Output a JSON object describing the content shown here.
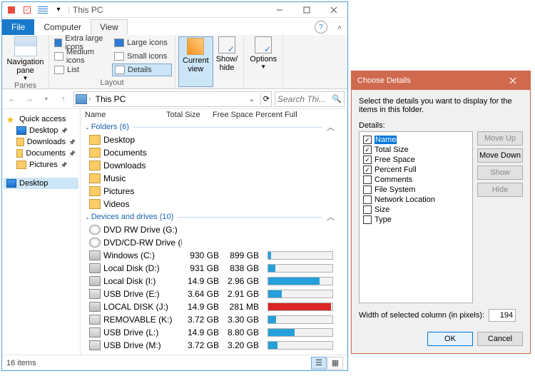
{
  "title": "This PC",
  "ribbonTabs": {
    "file": "File",
    "computer": "Computer",
    "view": "View"
  },
  "ribbon": {
    "panes": {
      "nav": "Navigation\npane",
      "label": "Panes"
    },
    "layout": {
      "xl": "Extra large icons",
      "lg": "Large icons",
      "md": "Medium icons",
      "sm": "Small icons",
      "list": "List",
      "details": "Details",
      "label": "Layout"
    },
    "currentview": "Current\nview",
    "showhide": "Show/\nhide",
    "options": "Options"
  },
  "address": {
    "path": "This PC",
    "searchPlaceholder": "Search Thi..."
  },
  "tree": {
    "quick": "Quick access",
    "desktop": "Desktop",
    "downloads": "Downloads",
    "documents": "Documents",
    "pictures": "Pictures",
    "desktop2": "Desktop"
  },
  "columns": {
    "name": "Name",
    "totalSize": "Total Size",
    "freeSpace": "Free Space",
    "percentFull": "Percent Full"
  },
  "groups": {
    "folders": {
      "label": "Folders (6)"
    },
    "drives": {
      "label": "Devices and drives (10)"
    }
  },
  "folders": [
    "Desktop",
    "Documents",
    "Downloads",
    "Music",
    "Pictures",
    "Videos"
  ],
  "drives": [
    {
      "name": "DVD RW Drive (G:)",
      "ts": "",
      "fs": "",
      "pct": null,
      "ico": "disc"
    },
    {
      "name": "DVD/CD-RW Drive (H:)",
      "ts": "",
      "fs": "",
      "pct": null,
      "ico": "disc"
    },
    {
      "name": "Windows (C:)",
      "ts": "930 GB",
      "fs": "899 GB",
      "pct": 4,
      "ico": "drive"
    },
    {
      "name": "Local Disk (D:)",
      "ts": "931 GB",
      "fs": "838 GB",
      "pct": 11,
      "ico": "drive"
    },
    {
      "name": "Local Disk (I:)",
      "ts": "14.9 GB",
      "fs": "2.96 GB",
      "pct": 80,
      "ico": "drive"
    },
    {
      "name": "USB Drive (E:)",
      "ts": "3.64 GB",
      "fs": "2.91 GB",
      "pct": 21,
      "ico": "usb"
    },
    {
      "name": "LOCAL DISK (J:)",
      "ts": "14.9 GB",
      "fs": "281 MB",
      "pct": 98,
      "ico": "drive",
      "red": true
    },
    {
      "name": "REMOVABLE (K:)",
      "ts": "3.72 GB",
      "fs": "3.30 GB",
      "pct": 12,
      "ico": "usb"
    },
    {
      "name": "USB Drive (L:)",
      "ts": "14.9 GB",
      "fs": "8.80 GB",
      "pct": 41,
      "ico": "usb"
    },
    {
      "name": "USB Drive (M:)",
      "ts": "3.72 GB",
      "fs": "3.20 GB",
      "pct": 14,
      "ico": "usb"
    }
  ],
  "status": {
    "count": "16 items"
  },
  "dialog": {
    "title": "Choose Details",
    "intro": "Select the details you want to display for the items in this folder.",
    "detailsLabel": "Details:",
    "items": [
      {
        "label": "Name",
        "checked": true,
        "selected": true
      },
      {
        "label": "Total Size",
        "checked": true
      },
      {
        "label": "Free Space",
        "checked": true
      },
      {
        "label": "Percent Full",
        "checked": true
      },
      {
        "label": "Comments",
        "checked": false
      },
      {
        "label": "File System",
        "checked": false
      },
      {
        "label": "Network Location",
        "checked": false
      },
      {
        "label": "Size",
        "checked": false
      },
      {
        "label": "Type",
        "checked": false
      }
    ],
    "buttons": {
      "moveUp": "Move Up",
      "moveDown": "Move Down",
      "show": "Show",
      "hide": "Hide",
      "ok": "OK",
      "cancel": "Cancel"
    },
    "widthLabel": "Width of selected column (in pixels):",
    "widthValue": "194"
  }
}
